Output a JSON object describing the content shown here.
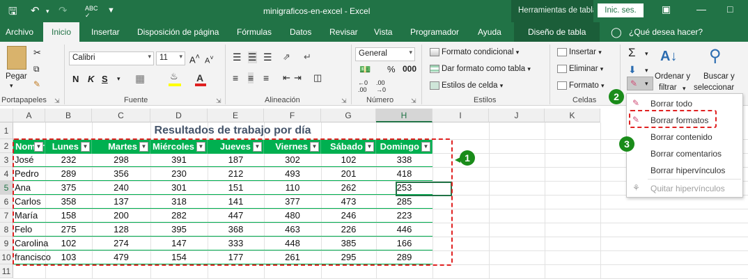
{
  "titlebar": {
    "file_title": "minigraficos-en-excel  -  Excel",
    "context_tools": "Herramientas de tabla",
    "signin": "Inic. ses."
  },
  "tabs": [
    "Archivo",
    "Inicio",
    "Insertar",
    "Disposición de página",
    "Fórmulas",
    "Datos",
    "Revisar",
    "Vista",
    "Programador",
    "Ayuda",
    "Diseño de tabla"
  ],
  "tell_me": "¿Qué desea hacer?",
  "ribbon": {
    "paste": "Pegar",
    "clipboard": "Portapapeles",
    "font_name": "Calibri",
    "font_size": "11",
    "font_group": "Fuente",
    "bold": "N",
    "italic": "K",
    "underline": "S",
    "alignment_group": "Alineación",
    "number_format": "General",
    "number_group": "Número",
    "cond_format": "Formato condicional",
    "table_format": "Dar formato como tabla",
    "cell_styles": "Estilos de celda",
    "styles_group": "Estilos",
    "insert": "Insertar",
    "delete": "Eliminar",
    "format": "Formato",
    "cells_group": "Celdas",
    "sort_filter_1": "Ordenar y",
    "sort_filter_2": "filtrar",
    "find_select_1": "Buscar y",
    "find_select_2": "seleccionar"
  },
  "columns": [
    "A",
    "B",
    "C",
    "D",
    "E",
    "F",
    "G",
    "H",
    "I",
    "J",
    "K"
  ],
  "rows": [
    "1",
    "2",
    "3",
    "4",
    "5",
    "6",
    "7",
    "8",
    "9",
    "10",
    "11"
  ],
  "sheet_title": "Resultados de trabajo por día",
  "table": {
    "headers": [
      "Nombre",
      "Lunes",
      "Martes",
      "Miércoles",
      "Jueves",
      "Viernes",
      "Sábado",
      "Domingo"
    ],
    "data": [
      [
        "José",
        "232",
        "298",
        "391",
        "187",
        "302",
        "102",
        "338"
      ],
      [
        "Pedro",
        "289",
        "356",
        "230",
        "212",
        "493",
        "201",
        "418"
      ],
      [
        "Ana",
        "375",
        "240",
        "301",
        "151",
        "110",
        "262",
        "253"
      ],
      [
        "Carlos",
        "358",
        "137",
        "318",
        "141",
        "377",
        "473",
        "285"
      ],
      [
        "María",
        "158",
        "200",
        "282",
        "447",
        "480",
        "246",
        "223"
      ],
      [
        "Felo",
        "275",
        "128",
        "395",
        "368",
        "463",
        "226",
        "446"
      ],
      [
        "Carolina",
        "102",
        "274",
        "147",
        "333",
        "448",
        "385",
        "166"
      ],
      [
        "francisco",
        "103",
        "479",
        "154",
        "177",
        "261",
        "295",
        "289"
      ]
    ]
  },
  "menu": {
    "items": [
      "Borrar todo",
      "Borrar formatos",
      "Borrar contenido",
      "Borrar comentarios",
      "Borrar hipervínculos",
      "Quitar hipervínculos"
    ]
  },
  "badges": [
    "1",
    "2",
    "3"
  ],
  "colors": {
    "accent": "#217346",
    "table_header": "#00b050",
    "highlight": "#e02020",
    "badge": "#1a8c1a"
  }
}
